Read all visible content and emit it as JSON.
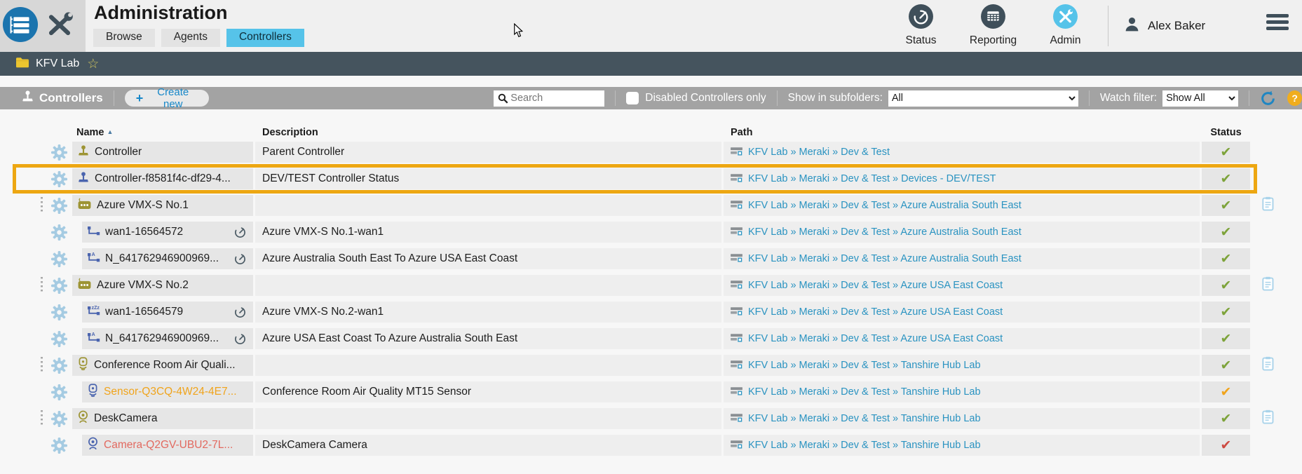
{
  "header": {
    "title": "Administration",
    "tabs": [
      {
        "label": "Browse",
        "active": false
      },
      {
        "label": "Agents",
        "active": false
      },
      {
        "label": "Controllers",
        "active": true
      }
    ],
    "nav": [
      {
        "label": "Status",
        "icon": "gauge-icon",
        "variant": "dark"
      },
      {
        "label": "Reporting",
        "icon": "report-grid-icon",
        "variant": "dark"
      },
      {
        "label": "Admin",
        "icon": "crossed-tools-icon",
        "variant": "blue"
      }
    ],
    "user_name": "Alex Baker"
  },
  "breadcrumb": {
    "folder_name": "KFV Lab"
  },
  "toolbar": {
    "section_label": "Controllers",
    "create_label": "Create new",
    "search_placeholder": "Search",
    "disabled_only_label": "Disabled Controllers only",
    "subfolders_label": "Show in subfolders:",
    "subfolders_value": "All",
    "watch_label": "Watch filter:",
    "watch_value": "Show All"
  },
  "table": {
    "columns": {
      "name": "Name",
      "description": "Description",
      "path": "Path",
      "status": "Status"
    },
    "sort_indicator": "▲",
    "rows": [
      {
        "name": "Controller",
        "icon": "joystick-icon",
        "icon_color": "olive",
        "name_color": "default",
        "indent": 0,
        "handle": false,
        "gauge": false,
        "description": "Parent Controller",
        "path": "KFV Lab » Meraki » Dev & Test",
        "status": "ok",
        "clipboard": false,
        "highlighted": false
      },
      {
        "name": "Controller-f8581f4c-df29-4...",
        "icon": "joystick-icon",
        "icon_color": "blue",
        "name_color": "default",
        "indent": 0,
        "handle": false,
        "gauge": false,
        "description": "DEV/TEST Controller Status",
        "path": "KFV Lab » Meraki » Dev & Test » Devices - DEV/TEST",
        "status": "ok",
        "clipboard": false,
        "highlighted": true
      },
      {
        "name": "Azure VMX-S No.1",
        "icon": "router-icon",
        "icon_color": "olive",
        "name_color": "default",
        "indent": 0,
        "handle": true,
        "gauge": false,
        "description": "",
        "path": "KFV Lab » Meraki » Dev & Test » Azure Australia South East",
        "status": "ok",
        "clipboard": true,
        "highlighted": false
      },
      {
        "name": "wan1-16564572",
        "icon": "wan-link-icon",
        "icon_color": "blue",
        "name_color": "default",
        "indent": 1,
        "handle": false,
        "gauge": true,
        "description": "Azure VMX-S No.1-wan1",
        "path": "KFV Lab » Meraki » Dev & Test » Azure Australia South East",
        "status": "ok",
        "clipboard": false,
        "highlighted": false
      },
      {
        "name": "N_641762946900969...",
        "icon": "vpn-tunnel-icon",
        "icon_color": "blue",
        "name_color": "default",
        "indent": 1,
        "handle": false,
        "gauge": true,
        "description": "Azure Australia South East To Azure USA East Coast",
        "path": "KFV Lab » Meraki » Dev & Test » Azure Australia South East",
        "status": "ok",
        "clipboard": false,
        "highlighted": false
      },
      {
        "name": "Azure VMX-S No.2",
        "icon": "router-icon",
        "icon_color": "olive",
        "name_color": "default",
        "indent": 0,
        "handle": true,
        "gauge": false,
        "description": "",
        "path": "KFV Lab » Meraki » Dev & Test » Azure USA East Coast",
        "status": "ok",
        "clipboard": true,
        "highlighted": false
      },
      {
        "name": "wan1-16564579",
        "icon": "wan-link-sleep-icon",
        "icon_color": "blue",
        "name_color": "default",
        "indent": 1,
        "handle": false,
        "gauge": true,
        "description": "Azure VMX-S No.2-wan1",
        "path": "KFV Lab » Meraki » Dev & Test » Azure USA East Coast",
        "status": "ok",
        "clipboard": false,
        "highlighted": false
      },
      {
        "name": "N_641762946900969...",
        "icon": "vpn-tunnel-icon",
        "icon_color": "blue",
        "name_color": "default",
        "indent": 1,
        "handle": false,
        "gauge": true,
        "description": "Azure USA East Coast To Azure Australia South East",
        "path": "KFV Lab » Meraki » Dev & Test » Azure USA East Coast",
        "status": "ok",
        "clipboard": false,
        "highlighted": false
      },
      {
        "name": "Conference Room Air Quali...",
        "icon": "sensor-icon",
        "icon_color": "olive",
        "name_color": "default",
        "indent": 0,
        "handle": true,
        "gauge": false,
        "description": "",
        "path": "KFV Lab » Meraki » Dev & Test » Tanshire Hub Lab",
        "status": "ok",
        "clipboard": true,
        "highlighted": false
      },
      {
        "name": "Sensor-Q3CQ-4W24-4E7...",
        "icon": "sensor-icon",
        "icon_color": "blue",
        "name_color": "orange",
        "indent": 1,
        "handle": false,
        "gauge": false,
        "description": "Conference Room Air Quality MT15 Sensor",
        "path": "KFV Lab » Meraki » Dev & Test » Tanshire Hub Lab",
        "status": "warning",
        "clipboard": false,
        "highlighted": false
      },
      {
        "name": "DeskCamera",
        "icon": "camera-icon",
        "icon_color": "olive",
        "name_color": "default",
        "indent": 0,
        "handle": true,
        "gauge": false,
        "description": "",
        "path": "KFV Lab » Meraki » Dev & Test » Tanshire Hub Lab",
        "status": "ok",
        "clipboard": true,
        "highlighted": false
      },
      {
        "name": "Camera-Q2GV-UBU2-7L...",
        "icon": "camera-icon",
        "icon_color": "blue",
        "name_color": "red",
        "indent": 1,
        "handle": false,
        "gauge": false,
        "description": "DeskCamera Camera",
        "path": "KFV Lab » Meraki » Dev & Test » Tanshire Hub Lab",
        "status": "error",
        "clipboard": false,
        "highlighted": false
      }
    ]
  },
  "colors": {
    "tab_active": "#56c3e9",
    "link": "#2a93c1",
    "olive": "#9d9434",
    "blue": "#4a64ae",
    "status_ok": "#7da33a",
    "status_warning": "#f0a41c",
    "status_error": "#cd4a41",
    "name_orange": "#f0a41c",
    "name_red": "#e2695f",
    "highlight": "#eda712",
    "gear": "#a5cbe2",
    "clipboard": "#a9d3ea"
  }
}
